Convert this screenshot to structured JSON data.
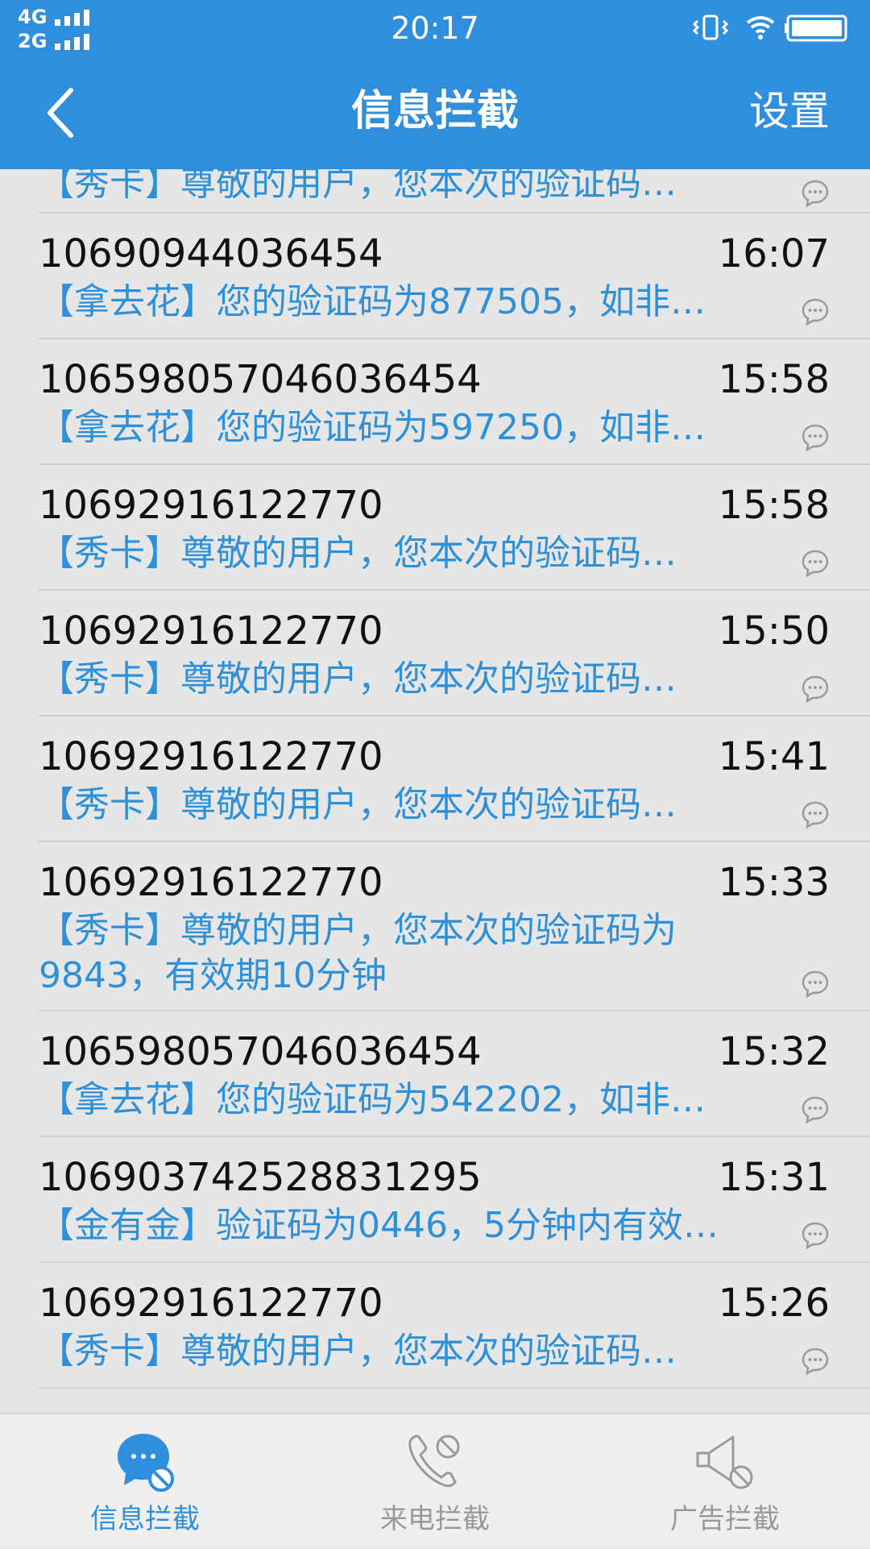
{
  "status_bar": {
    "network_4g": "4G",
    "network_2g": "2G",
    "time": "20:17",
    "icons": [
      "vibrate-icon",
      "wifi-icon",
      "battery-icon"
    ]
  },
  "nav": {
    "title": "信息拦截",
    "settings_label": "设置",
    "back_icon": "chevron-left-icon"
  },
  "messages": [
    {
      "sender": "",
      "time": "",
      "preview": "【秀卡】尊敬的用户，您本次的验证码…"
    },
    {
      "sender": "10690944036454",
      "time": "16:07",
      "preview": "【拿去花】您的验证码为877505，如非…"
    },
    {
      "sender": "106598057046036454",
      "time": "15:58",
      "preview": "【拿去花】您的验证码为597250，如非…"
    },
    {
      "sender": "10692916122770",
      "time": "15:58",
      "preview": "【秀卡】尊敬的用户，您本次的验证码…"
    },
    {
      "sender": "10692916122770",
      "time": "15:50",
      "preview": "【秀卡】尊敬的用户，您本次的验证码…"
    },
    {
      "sender": "10692916122770",
      "time": "15:41",
      "preview": "【秀卡】尊敬的用户，您本次的验证码…"
    },
    {
      "sender": "10692916122770",
      "time": "15:33",
      "preview": "【秀卡】尊敬的用户，您本次的验证码为9843，有效期10分钟"
    },
    {
      "sender": "106598057046036454",
      "time": "15:32",
      "preview": "【拿去花】您的验证码为542202，如非…"
    },
    {
      "sender": "106903742528831295",
      "time": "15:31",
      "preview": "【金有金】验证码为0446，5分钟内有效…"
    },
    {
      "sender": "10692916122770",
      "time": "15:26",
      "preview": "【秀卡】尊敬的用户，您本次的验证码…"
    }
  ],
  "tabs": [
    {
      "label": "信息拦截",
      "icon": "message-block-icon",
      "active": true
    },
    {
      "label": "来电拦截",
      "icon": "call-block-icon",
      "active": false
    },
    {
      "label": "广告拦截",
      "icon": "ad-block-icon",
      "active": false
    }
  ],
  "colors": {
    "accent": "#2f8fdc",
    "preview_text": "#2e90d8",
    "list_bg": "#e6e6e6",
    "tab_inactive": "#999999"
  }
}
